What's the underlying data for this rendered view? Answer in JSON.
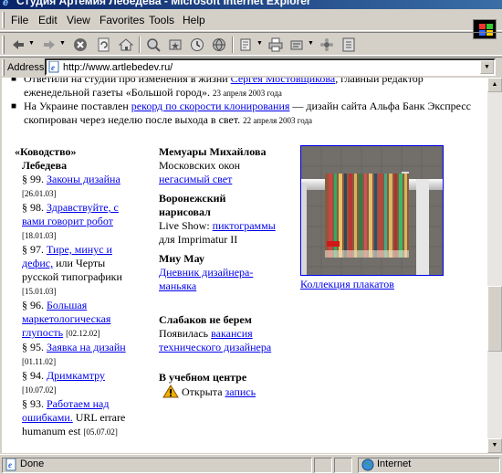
{
  "window": {
    "title": "Студия Артемия Лебедева - Microsoft Internet Explorer"
  },
  "menu": {
    "file": "File",
    "edit": "Edit",
    "view": "View",
    "favorites": "Favorites",
    "tools": "Tools",
    "help": "Help"
  },
  "toolbar": {
    "icons": [
      "back-icon",
      "forward-icon",
      "stop-icon",
      "refresh-icon",
      "home-icon",
      "search-icon",
      "favorites-icon",
      "history-icon",
      "mail-icon",
      "print-icon",
      "edit-icon",
      "discuss-icon",
      "messenger-icon"
    ]
  },
  "address": {
    "label": "Address",
    "url": "http://www.artlebedev.ru/"
  },
  "news": [
    {
      "prefix": "Ответили на студии про изменения в жизни ",
      "link": "Сергея Мостовщикова",
      "suffix": ", главный редактор еженедельной газеты «Большой город».",
      "date": "23 апреля 2003 года"
    },
    {
      "prefix": "На Украине поставлен ",
      "link": "рекорд по скорости клонирования",
      "suffix": " — дизайн сайта Альфа Банк Экспресс скопирован через неделю после выхода в свет.",
      "date": "22 апреля 2003 года"
    }
  ],
  "kovodstvo": {
    "title_line1": "«Ководство»",
    "title_line2": "Лебедева",
    "entries": [
      {
        "num": "§ 99.",
        "link": "Законы дизайна",
        "rest": "",
        "date": "[26.01.03]"
      },
      {
        "num": "§ 98.",
        "link": "Здравствуйте, с вами говорит робот",
        "rest": "",
        "date": "[18.01.03]"
      },
      {
        "num": "§ 97.",
        "link": "Тире, минус и дефис,",
        "rest": " или Черты русской типографики",
        "date": "[15.01.03]"
      },
      {
        "num": "§ 96.",
        "link": "Большая маркетологическая глупость",
        "rest": "",
        "date": "[02.12.02]"
      },
      {
        "num": "§ 95.",
        "link": "Заявка на дизайн",
        "rest": "",
        "date": "[01.11.02]"
      },
      {
        "num": "§ 94.",
        "link": "Дримкамтру",
        "rest": "",
        "date": "[10.07.02]"
      },
      {
        "num": "§ 93.",
        "link": "Работаем над ошибками.",
        "rest": " URL errare humanum est",
        "date": "[05.07.02]"
      }
    ]
  },
  "middle": {
    "memuary_title": "Мемуары Михайлова",
    "memuary_text": "Московских окон ",
    "memuary_link": "негасимый свет",
    "voronezh_title": "Воронежский нарисовал",
    "voronezh_text1": "Live Show: ",
    "voronezh_link": "пиктограммы",
    "voronezh_text2": " для Imprimatur II",
    "miu_title": "Миу Мау",
    "miu_link": "Дневник дизайнера-маньяка",
    "slabakov_title": "Слабаков не берем",
    "slabakov_text": "Появилась ",
    "slabakov_link": "вакансия технического дизайнера",
    "ucheb_title": "В учебном центре",
    "ucheb_text": "Открыта ",
    "ucheb_link": "запись"
  },
  "poster": {
    "caption": "Коллекция плакатов"
  },
  "status": {
    "text": "Done",
    "zone": "Internet"
  },
  "colors": {
    "link": "#0000ee",
    "chrome": "#d4d0c8",
    "title_start": "#0a246a",
    "title_end": "#3a6ea5"
  }
}
